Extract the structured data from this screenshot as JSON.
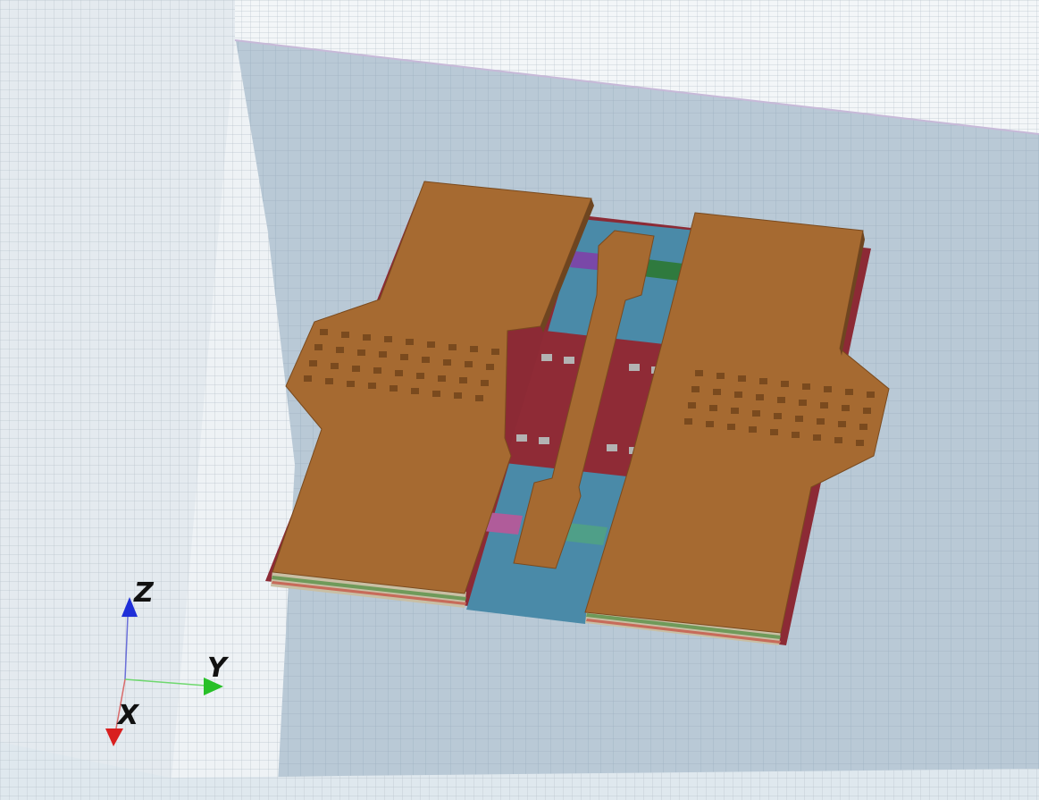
{
  "axes": {
    "z_label": "Z",
    "y_label": "Y",
    "x_label": "X"
  },
  "colors": {
    "background_grid": "#b9c9d6",
    "wall_grid": "#e9eef2",
    "substrate": "#8c2a35",
    "dielectric": "#4a8aa8",
    "metal": "#a66a31",
    "via_pad": "#b3b3b3",
    "port_purple": "#7a48a8",
    "port_green": "#2f7a3e",
    "port_pink": "#b05c9a",
    "port_teal": "#4f9f88",
    "axis_z": "#1f2fd8",
    "axis_y": "#28c028",
    "axis_x": "#d81f1f"
  }
}
